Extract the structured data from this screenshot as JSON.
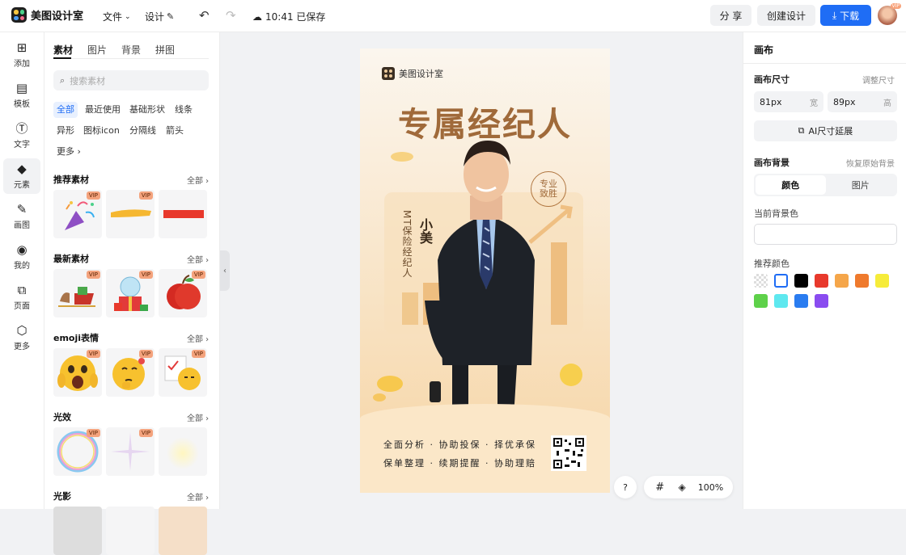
{
  "app": {
    "name": "美图设计室"
  },
  "topbar": {
    "file_menu": "文件",
    "design_menu": "设计",
    "save_status": "10:41 已保存",
    "share_label": "分 享",
    "create_label": "创建设计",
    "download_label": "下载",
    "avatar_badge": "VIP"
  },
  "rail": [
    {
      "label": "添加",
      "icon": "plus-square-icon"
    },
    {
      "label": "模板",
      "icon": "template-icon"
    },
    {
      "label": "文字",
      "icon": "text-icon"
    },
    {
      "label": "元素",
      "icon": "element-icon"
    },
    {
      "label": "画图",
      "icon": "draw-icon"
    },
    {
      "label": "我的",
      "icon": "user-icon"
    },
    {
      "label": "页面",
      "icon": "page-icon"
    },
    {
      "label": "更多",
      "icon": "more-box-icon"
    }
  ],
  "panel": {
    "tabs": [
      "素材",
      "图片",
      "背景",
      "拼图"
    ],
    "search_placeholder": "搜索素材",
    "chips": [
      "全部",
      "最近使用",
      "基础形状",
      "线条",
      "异形",
      "图标icon",
      "分隔线",
      "箭头",
      "更多"
    ],
    "sections": [
      {
        "title": "推荐素材",
        "all": "全部"
      },
      {
        "title": "最新素材",
        "all": "全部"
      },
      {
        "title": "emoji表情",
        "all": "全部"
      },
      {
        "title": "光效",
        "all": "全部"
      },
      {
        "title": "光影",
        "all": "全部"
      }
    ],
    "vip": "VIP"
  },
  "poster": {
    "brand": "美图设计室",
    "title": "专属经纪人",
    "badge_line1": "专业",
    "badge_line2": "致胜",
    "vertical_text": "MT保险经纪人",
    "name": "小美",
    "line1": "全面分析 · 协助投保 · 择优承保",
    "line2": "保单整理 · 续期提醒 · 协助理赔"
  },
  "right": {
    "title": "画布",
    "size_label": "画布尺寸",
    "size_link": "调整尺寸",
    "width_value": "81px",
    "width_unit": "宽",
    "height_value": "89px",
    "height_unit": "高",
    "ai_button": "AI尺寸延展",
    "bg_label": "画布背景",
    "bg_link": "恢复原始背景",
    "seg_color": "颜色",
    "seg_image": "图片",
    "current_bg": "当前背景色",
    "recommend": "推荐颜色",
    "swatches": [
      "#ffffff",
      "#000000",
      "#e8392c",
      "#f5a64a",
      "#ef7a2d",
      "#f6ec3a",
      "#5ed14a",
      "#5ee8ef",
      "#2a7cf0",
      "#8a4cf0"
    ]
  },
  "zoom": {
    "help": "?",
    "level": "100%"
  }
}
